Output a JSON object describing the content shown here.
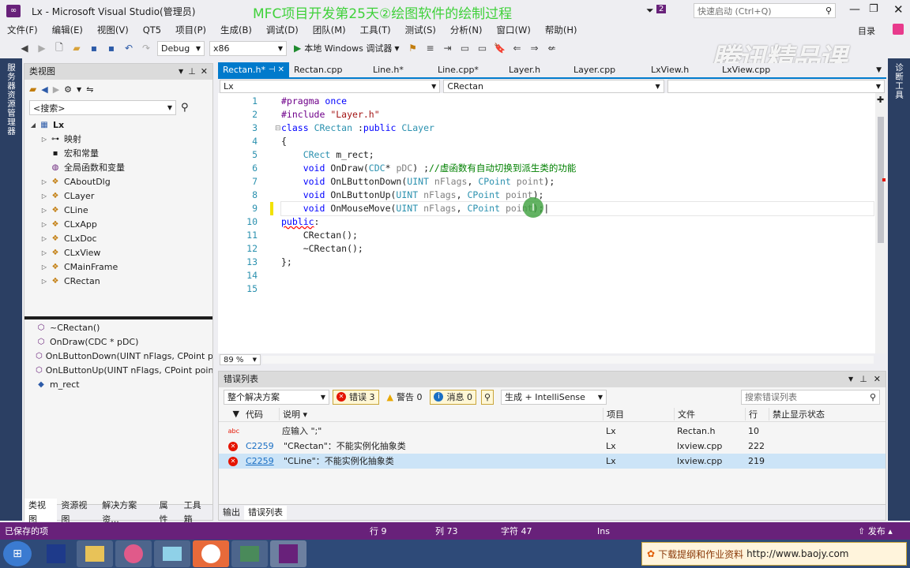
{
  "window": {
    "title": "Lx - Microsoft Visual Studio(管理员)",
    "overlay_title": "MFC项目开发第25天②绘图软件的绘制过程",
    "notifications": "2",
    "quick_launch_placeholder": "快速启动 (Ctrl+Q)",
    "account": "目录",
    "watermark": "腾讯精品课"
  },
  "menu": [
    "文件(F)",
    "编辑(E)",
    "视图(V)",
    "QT5",
    "项目(P)",
    "生成(B)",
    "调试(D)",
    "团队(M)",
    "工具(T)",
    "测试(S)",
    "分析(N)",
    "窗口(W)",
    "帮助(H)"
  ],
  "toolbar": {
    "config": "Debug",
    "platform": "x86",
    "run_label": "本地 Windows 调试器"
  },
  "left_vtab": "服务器资源管理器",
  "right_vtab": "诊断工具",
  "class_view": {
    "title": "类视图",
    "search_placeholder": "<搜索>",
    "root": "Lx",
    "items": [
      "映射",
      "宏和常量",
      "全局函数和变量",
      "CAboutDlg",
      "CLayer",
      "CLine",
      "CLxApp",
      "CLxDoc",
      "CLxView",
      "CMainFrame",
      "CRectan"
    ],
    "members": [
      "~CRectan()",
      "OnDraw(CDC * pDC)",
      "OnLButtonDown(UINT nFlags, CPoint point)",
      "OnLButtonUp(UINT nFlags, CPoint point)",
      "m_rect"
    ],
    "bottom_tabs": [
      "类视图",
      "资源视图",
      "解决方案资...",
      "属性",
      "工具箱"
    ]
  },
  "editor": {
    "tabs": [
      "Rectan.h*",
      "Rectan.cpp",
      "Line.h*",
      "Line.cpp*",
      "Layer.h",
      "Layer.cpp",
      "LxView.h",
      "LxView.cpp"
    ],
    "nav_project": "Lx",
    "nav_class": "CRectan",
    "zoom": "89 %",
    "line_numbers": [
      "1",
      "2",
      "3",
      "4",
      "5",
      "6",
      "7",
      "8",
      "9",
      "10",
      "11",
      "12",
      "13",
      "14",
      "15"
    ]
  },
  "error_list": {
    "title": "错误列表",
    "scope": "整个解决方案",
    "errors_btn": "错误 3",
    "warnings_btn": "警告 0",
    "messages_btn": "消息 0",
    "build_filter": "生成 + IntelliSense",
    "search_placeholder": "搜索错误列表",
    "columns": {
      "code": "代码",
      "desc": "说明",
      "project": "项目",
      "file": "文件",
      "line": "行",
      "suppress": "禁止显示状态"
    },
    "rows": [
      {
        "code": "",
        "desc": "应输入 \";\"",
        "project": "Lx",
        "file": "Rectan.h",
        "line": "10"
      },
      {
        "code": "C2259",
        "desc": "\"CRectan\"：不能实例化抽象类",
        "project": "Lx",
        "file": "lxview.cpp",
        "line": "222"
      },
      {
        "code": "C2259",
        "desc": "\"CLine\"：不能实例化抽象类",
        "project": "Lx",
        "file": "lxview.cpp",
        "line": "219"
      }
    ],
    "bottom_tabs": [
      "输出",
      "错误列表"
    ]
  },
  "status": {
    "saved": "已保存的项",
    "row": "行 9",
    "col": "列 73",
    "char": "字符 47",
    "mode": "Ins",
    "publish": "发布"
  },
  "taskbar": {
    "ad_text": "下载提纲和作业资料",
    "ad_url": "http://www.baojy.com"
  }
}
